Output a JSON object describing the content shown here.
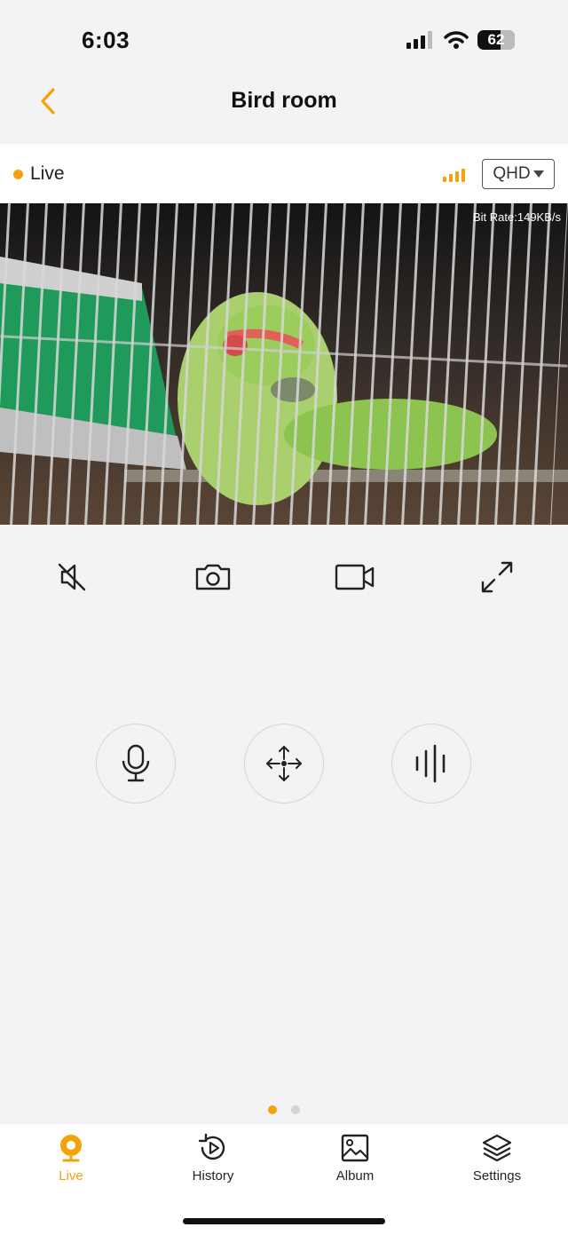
{
  "status_bar": {
    "time": "6:03",
    "battery": "62"
  },
  "nav": {
    "title": "Bird room"
  },
  "live_bar": {
    "live_label": "Live",
    "quality": "QHD"
  },
  "video": {
    "bit_rate": "Bit Rate:149KB/s"
  },
  "controls": {
    "icons": [
      "mute-icon",
      "camera-icon",
      "video-record-icon",
      "fullscreen-icon"
    ]
  },
  "actions": {
    "icons": [
      "microphone-icon",
      "pan-tilt-icon",
      "voice-wave-icon"
    ]
  },
  "pager": {
    "active_page": 1,
    "total_pages": 2
  },
  "tabs": {
    "live": "Live",
    "history": "History",
    "album": "Album",
    "settings": "Settings"
  },
  "colors": {
    "accent": "#f4a20c",
    "background": "#f3f3f5"
  }
}
